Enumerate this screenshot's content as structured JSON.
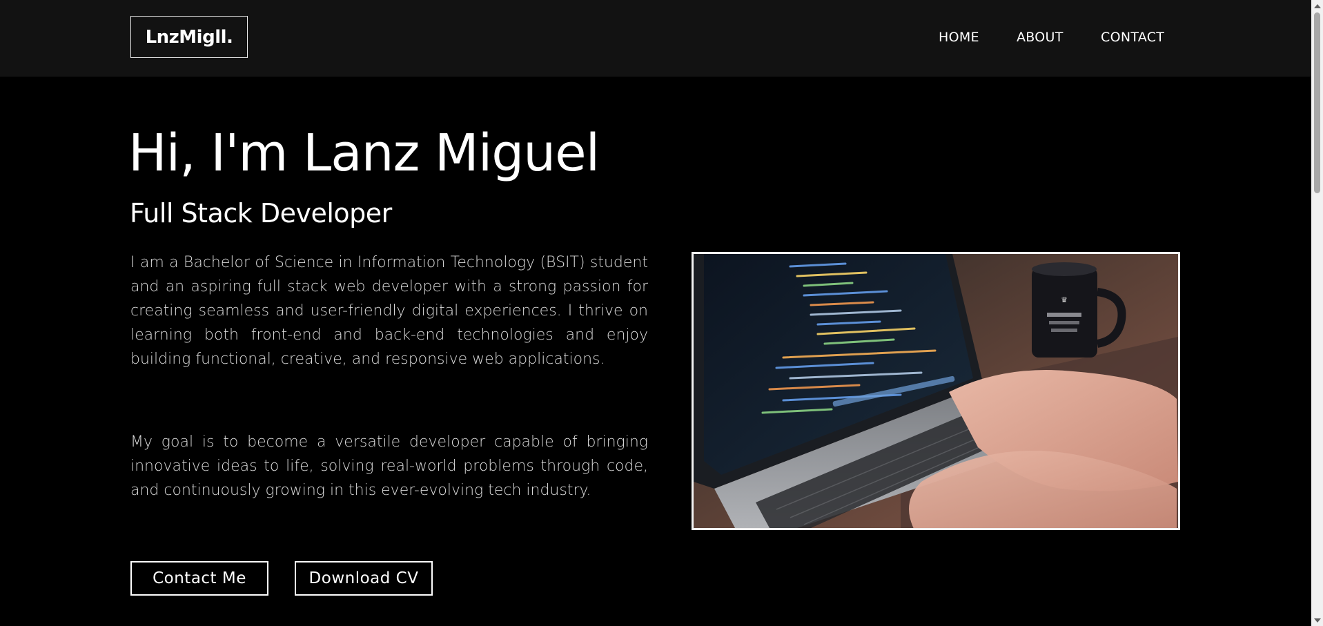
{
  "header": {
    "logo": "LnzMigll.",
    "nav": [
      {
        "label": "HOME"
      },
      {
        "label": "ABOUT"
      },
      {
        "label": "CONTACT"
      }
    ]
  },
  "hero": {
    "title": "Hi, I'm Lanz Miguel",
    "subtitle": "Full Stack Developer",
    "paragraphs": [
      "I am a Bachelor of Science in Information Technology (BSIT) student and an aspiring full stack web developer with a strong passion for creating seamless and user-friendly digital experiences. I thrive on learning both front-end and back-end technologies and enjoy building functional, creative, and responsive web applications.",
      "My goal is to become a versatile developer capable of bringing innovative ideas to life, solving real-world problems through code, and continuously growing in this ever-evolving tech industry."
    ],
    "buttons": {
      "contact": "Contact Me",
      "download_cv": "Download CV"
    },
    "image": {
      "subject": "laptop-with-code-and-coffee-mug"
    }
  },
  "colors": {
    "page_background": "#000000",
    "header_background": "#121212",
    "text": "#ffffff",
    "body_text": "#d9d9d9"
  }
}
